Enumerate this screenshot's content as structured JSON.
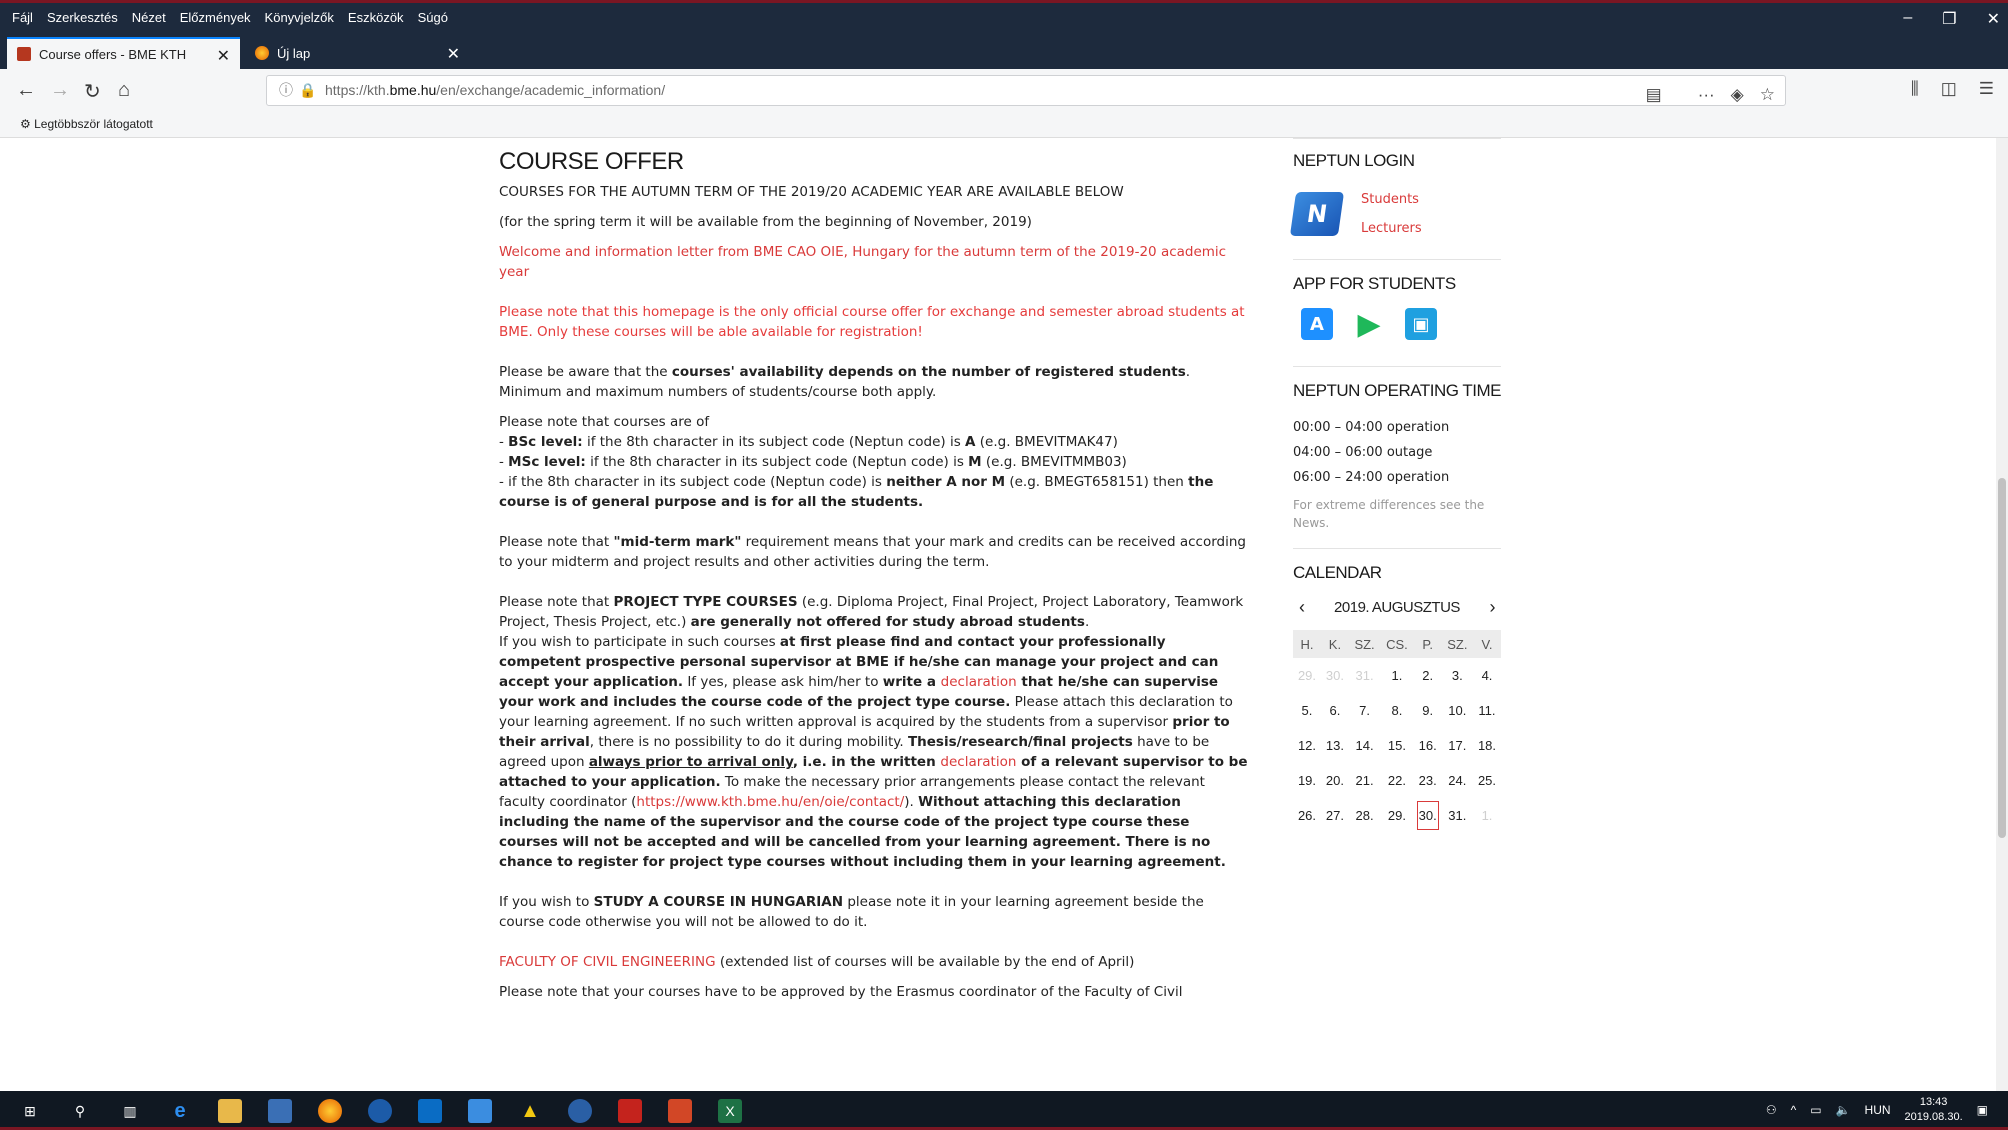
{
  "browser": {
    "menu": [
      "Fájl",
      "Szerkesztés",
      "Nézet",
      "Előzmények",
      "Könyvjelzők",
      "Eszközök",
      "Súgó"
    ],
    "tabs": [
      {
        "title": "Course offers - BME KTH",
        "active": true
      },
      {
        "title": "Új lap",
        "active": false
      }
    ],
    "url_prefix": "https://kth.",
    "url_host": "bme.hu",
    "url_path": "/en/exchange/academic_information/",
    "bookmark": "Legtöbbször látogatott"
  },
  "page": {
    "title": "COURSE OFFER",
    "intro1": "COURSES FOR THE AUTUMN TERM OF THE 2019/20 ACADEMIC YEAR ARE AVAILABLE BELOW",
    "intro2": "(for the spring term it will be available from the beginning of November, 2019)",
    "welcome_link": "Welcome and information letter from BME CAO OIE, Hungary for the autumn term of the 2019-20 academic year",
    "official_note": "Please note that this homepage is the only official course offer for exchange and semester abroad students at BME. Only these courses will be able available for registration!",
    "avail_a": "Please be aware that the ",
    "avail_b": "courses' availability depends on the number of registered students",
    "avail_c": ". Minimum and maximum numbers of students/course both apply.",
    "levels_intro": "Please note that courses are of",
    "bsc_label": "BSc level:",
    "bsc_text": " if the 8th character in its subject code (Neptun code) is ",
    "bsc_code": "A",
    "bsc_eg": " (e.g. BMEVITMAK47)",
    "msc_label": "MSc level:",
    "msc_text": " if the 8th character in its subject code (Neptun code) is ",
    "msc_code": "M",
    "msc_eg": " (e.g. BMEVITMMB03)",
    "gen_text": "- if the 8th character in its subject code (Neptun code) is ",
    "gen_code": "neither A nor M",
    "gen_eg": " (e.g. BMEGT658151) then ",
    "gen_bold": "the course is of general purpose and is for all the students.",
    "midterm_a": "Please note that ",
    "midterm_b": "\"mid-term mark\"",
    "midterm_c": " requirement means that your mark and credits can be received according to your midterm and project results and other activities during the term.",
    "proj_a": "Please note that ",
    "proj_b": "PROJECT TYPE COURSES",
    "proj_c": " (e.g. Diploma Project, Final Project, Project Laboratory, Teamwork Project, Thesis Project, etc.) ",
    "proj_d": "are generally not offered for study abroad students",
    "proj_e": ".",
    "proj2_a": "If you wish to participate in such courses ",
    "proj2_b": "at first please find and contact your professionally competent prospective personal supervisor at BME if he/she can manage your project and can accept your application.",
    "proj2_c": " If yes, please ask him/her to ",
    "proj2_d": "write a ",
    "declaration": "declaration",
    "proj2_e": " that he/she can supervise your work and includes the course code of the project type course.",
    "proj2_f": " Please attach this declaration to your learning agreement. If no such written approval is acquired by the students from a supervisor ",
    "proj2_g": "prior to their arrival",
    "proj2_h": ", there is no possibility to do it during mobility. ",
    "proj2_i": "Thesis/research/final projects",
    "proj2_j": " have to be agreed upon ",
    "proj2_k": "always prior to arrival only",
    "proj2_l": ", i.e. in the written ",
    "proj2_m": " of a relevant supervisor to be attached to your application.",
    "proj2_n": " To make the necessary prior arrangements please contact the relevant faculty coordinator (",
    "contact_url": "https://www.kth.bme.hu/en/oie/contact/",
    "proj2_o": "). ",
    "proj2_p": "Without attaching this declaration including the name of the supervisor and the course code of the project type course these courses will not be accepted and will be cancelled from your learning agreement. There is no chance to register for project type courses without including them in your learning agreement.",
    "hun_a": "If you wish to ",
    "hun_b": "STUDY A COURSE IN HUNGARIAN",
    "hun_c": " please note it in your learning agreement beside the course code otherwise you will not be allowed to do it.",
    "faculty_link": "FACULTY OF CIVIL ENGINEERING",
    "faculty_note": " (extended list of courses will be available by the end of April)",
    "approve_text": "Please note that your courses have to be approved by the Erasmus coordinator of the Faculty of Civil"
  },
  "sidebar": {
    "neptun_title": "NEPTUN LOGIN",
    "students": "Students",
    "lecturers": "Lecturers",
    "app_title": "APP FOR STUDENTS",
    "optime_title": "NEPTUN OPERATING TIME",
    "optime": [
      "00:00 – 04:00 operation",
      "04:00 – 06:00 outage",
      "06:00 – 24:00 operation"
    ],
    "optime_note": "For extreme differences see the News.",
    "cal_title": "CALENDAR",
    "cal_month": "2019. AUGUSZTUS",
    "weekdays": [
      "H.",
      "K.",
      "SZ.",
      "CS.",
      "P.",
      "SZ.",
      "V."
    ],
    "weeks": [
      [
        "29.",
        "30.",
        "31.",
        "1.",
        "2.",
        "3.",
        "4."
      ],
      [
        "5.",
        "6.",
        "7.",
        "8.",
        "9.",
        "10.",
        "11."
      ],
      [
        "12.",
        "13.",
        "14.",
        "15.",
        "16.",
        "17.",
        "18."
      ],
      [
        "19.",
        "20.",
        "21.",
        "22.",
        "23.",
        "24.",
        "25."
      ],
      [
        "26.",
        "27.",
        "28.",
        "29.",
        "30.",
        "31.",
        "1."
      ]
    ]
  },
  "taskbar": {
    "lang": "HUN",
    "time": "13:43",
    "date": "2019.08.30."
  },
  "colors": {
    "accent_red": "#d93a3a",
    "frame": "#7a1623",
    "chrome_dark": "#1d2a3d"
  }
}
